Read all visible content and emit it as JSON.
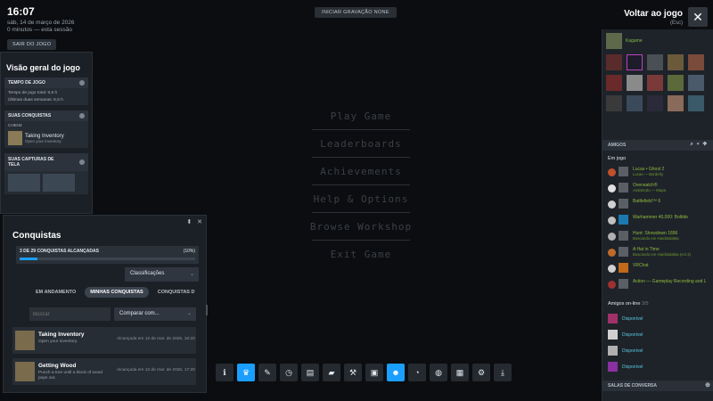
{
  "clock": {
    "time": "16:07",
    "date": "sáb, 14 de março de 2026",
    "session": "0 minutos — esta sessão"
  },
  "exit_label": "SAIR DO JOGO",
  "record_label": "INICIAR GRAVAÇÃO NONE",
  "back": {
    "title": "Voltar ao jogo",
    "key": "(Esc)",
    "close": "✕"
  },
  "game_menu": [
    "Play Game",
    "Leaderboards",
    "Achievements",
    "Help & Options",
    "Browse Workshop",
    "Exit Game"
  ],
  "overview": {
    "title": "Visão geral do jogo",
    "play_time": {
      "header": "TEMPO DE JOGO",
      "total": "Tempo de jogo total: 6,5 h",
      "recent": "Últimas duas semanas: 6,5 h"
    },
    "achievements": {
      "header": "SUAS CONQUISTAS",
      "label": "CHEIM",
      "name": "Taking Inventory",
      "desc": "Open your inventory."
    },
    "screenshots": {
      "header": "SUAS CAPTURAS DE TELA"
    }
  },
  "achievements_panel": {
    "title": "Conquistas",
    "progress_label": "3 DE 29 CONQUISTAS ALCANÇADAS",
    "progress_pct": "(10%)",
    "progress_value": 0.1,
    "sort_label": "Classificações",
    "tabs": [
      "EM ANDAMENTO",
      "MINHAS CONQUISTAS",
      "CONQUISTAS D"
    ],
    "search_placeholder": "Buscar",
    "compare_label": "Comparar com...",
    "items": [
      {
        "name": "Taking Inventory",
        "desc": "Open your inventory.",
        "date": "Alcançada em 12 de mar. de 2026, 16:20"
      },
      {
        "name": "Getting Wood",
        "desc": "Punch a tree until a block of wood pops out.",
        "date": "Alcançada em 12 de mar. de 2026, 17:20"
      }
    ]
  },
  "toolbar": [
    "info-icon",
    "achievements-icon",
    "pencil-icon",
    "clock-icon",
    "guide-icon",
    "chat-icon",
    "wrench-icon",
    "screenshots-icon",
    "friends-icon",
    "timer-icon",
    "controller-icon",
    "keyboard-icon",
    "settings-icon",
    "download-icon"
  ],
  "friends": {
    "me": "Kagame",
    "header": "AMIGOS",
    "in_game_label": "Em jogo",
    "in_game": [
      {
        "name": "Lucas • Ghost 2",
        "status": "Lucas — Borderly"
      },
      {
        "name": "Overwatch®",
        "status": "Assistindo — Mapa"
      },
      {
        "name": "Battlefield™ 6",
        "status": ""
      },
      {
        "name": "Warhammer 40,000: Boltide",
        "status": ""
      },
      {
        "name": "Hunt: Showdown 1896",
        "status": "Buscando em Hardstalakta"
      },
      {
        "name": "A Hat in Time",
        "status": "Buscando em Hardstalakta (ect 3)"
      },
      {
        "name": "VRChat",
        "status": ""
      },
      {
        "name": "Action — Gameplay Recording and L",
        "status": ""
      }
    ],
    "online_label": "Amigos on-line",
    "online_count": "3/5",
    "online": [
      "Disponível",
      "Disponível",
      "Disponível",
      "Disponível"
    ],
    "chat_header": "SALAS DE CONVERSA"
  }
}
